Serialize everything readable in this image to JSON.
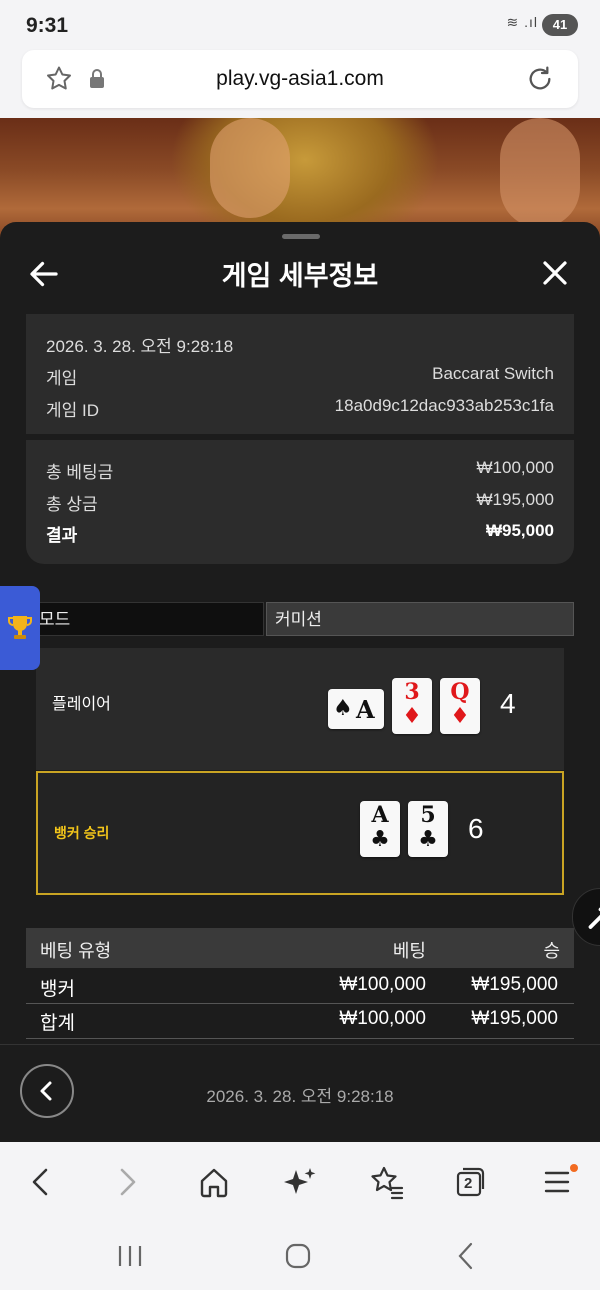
{
  "status": {
    "time": "9:31",
    "battery": "41"
  },
  "browser": {
    "url": "play.vg-asia1.com",
    "tabs_count": "2"
  },
  "sheet": {
    "title": "게임 세부정보",
    "info": {
      "date": "2026. 3. 28. 오전 9:28:18",
      "game_label": "게임",
      "game_value": "Baccarat Switch",
      "game_id_label": "게임 ID",
      "game_id_value": "18a0d9c12dac933ab253c1fa"
    },
    "totals": {
      "bet_label": "총 베팅금",
      "bet_value": "₩100,000",
      "prize_label": "총 상금",
      "prize_value": "₩195,000",
      "result_label": "결과",
      "result_value": "₩95,000"
    },
    "tabs": {
      "mode": "모드",
      "commission": "커미션"
    },
    "player": {
      "label": "플레이어",
      "score": "4",
      "cards": [
        {
          "rank": "A",
          "suit": "♠",
          "color": "#111111"
        },
        {
          "rank": "3",
          "suit": "♦",
          "color": "#e0181b"
        },
        {
          "rank": "Q",
          "suit": "♦",
          "color": "#e0181b"
        }
      ]
    },
    "banker": {
      "label": "뱅커 승리",
      "score": "6",
      "cards": [
        {
          "rank": "A",
          "suit": "♣",
          "color": "#111111"
        },
        {
          "rank": "5",
          "suit": "♣",
          "color": "#111111"
        }
      ]
    },
    "bets": {
      "headers": {
        "type": "베팅 유형",
        "bet": "베팅",
        "win": "승"
      },
      "rows": [
        {
          "type": "뱅커",
          "bet": "₩100,000",
          "win": "₩195,000"
        },
        {
          "type": "합계",
          "bet": "₩100,000",
          "win": "₩195,000"
        }
      ]
    },
    "footer_date": "2026. 3. 28. 오전 9:28:18"
  },
  "colors": {
    "accent_gold": "#c9a423",
    "banker_text": "#f2c51a",
    "sheet_bg": "#1c1c1c"
  }
}
